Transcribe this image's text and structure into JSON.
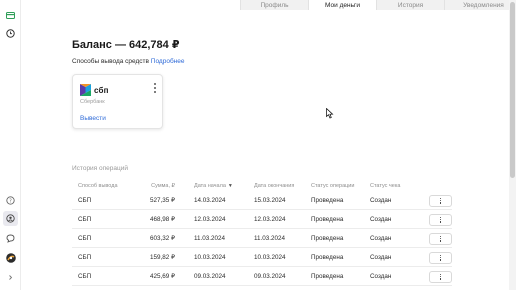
{
  "tabs": [
    {
      "label": "Профиль"
    },
    {
      "label": "Мои деньги"
    },
    {
      "label": "История"
    },
    {
      "label": "Уведомления"
    }
  ],
  "balance": {
    "text": "Баланс — 642,784 ₽"
  },
  "withdrawal_methods": {
    "label": "Способы вывода средств",
    "link": "Подробнее"
  },
  "card": {
    "logo_text": "сбп",
    "bank": "Сбербанк",
    "action": "Вывести"
  },
  "history": {
    "title": "История операций",
    "columns": [
      "Способ вывода",
      "Сумма, ₽",
      "Дата начала",
      "Дата окончания",
      "Статус операции",
      "Статус чека"
    ],
    "rows": [
      {
        "method": "СБП",
        "amount": "527,35 ₽",
        "start": "14.03.2024",
        "end": "15.03.2024",
        "status": "Проведена",
        "receipt": "Создан"
      },
      {
        "method": "СБП",
        "amount": "468,98 ₽",
        "start": "12.03.2024",
        "end": "12.03.2024",
        "status": "Проведена",
        "receipt": "Создан"
      },
      {
        "method": "СБП",
        "amount": "603,32 ₽",
        "start": "11.03.2024",
        "end": "11.03.2024",
        "status": "Проведена",
        "receipt": "Создан"
      },
      {
        "method": "СБП",
        "amount": "159,82 ₽",
        "start": "10.03.2024",
        "end": "10.03.2024",
        "status": "Проведена",
        "receipt": "Создан"
      },
      {
        "method": "СБП",
        "amount": "425,69 ₽",
        "start": "09.03.2024",
        "end": "09.03.2024",
        "status": "Проведена",
        "receipt": "Создан"
      }
    ]
  },
  "colors": {
    "accent": "#2f6bd8",
    "sbp_purple": "#5b3ba8",
    "sbp_orange": "#f39224",
    "sbp_green": "#1aa865",
    "sbp_blue": "#19a3e0"
  },
  "icons": {
    "sidebar": [
      "money-icon",
      "clock-icon",
      "help-icon",
      "profile-icon",
      "chat-icon",
      "avatar",
      "expand-icon"
    ]
  }
}
